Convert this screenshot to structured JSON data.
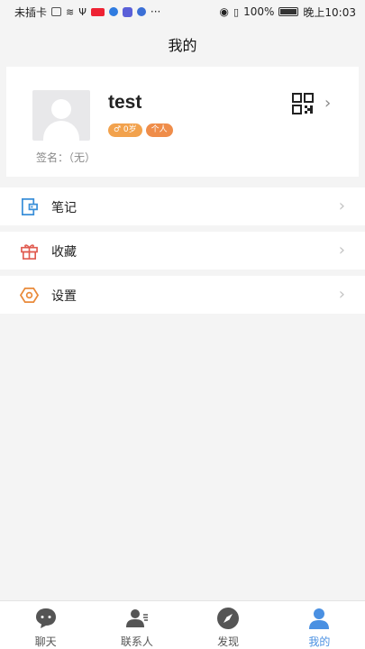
{
  "status_bar": {
    "carrier": "未插卡",
    "more": "···",
    "battery": "100%",
    "time": "晚上10:03",
    "red_badge": "头条"
  },
  "header": {
    "title": "我的"
  },
  "profile": {
    "username": "test",
    "age_badge": "♂ 0岁",
    "type_badge": "个人",
    "signature": "签名：（无）",
    "arrow": "›"
  },
  "menu": {
    "items": [
      {
        "label": "笔记",
        "icon": "note-icon",
        "color": "#3a8fd9"
      },
      {
        "label": "收藏",
        "icon": "gift-icon",
        "color": "#e05a4f"
      },
      {
        "label": "设置",
        "icon": "settings-icon",
        "color": "#e98a3a"
      }
    ],
    "arrow": "›"
  },
  "tabbar": {
    "tabs": [
      {
        "label": "聊天",
        "icon": "chat-icon"
      },
      {
        "label": "联系人",
        "icon": "contacts-icon"
      },
      {
        "label": "发现",
        "icon": "compass-icon"
      },
      {
        "label": "我的",
        "icon": "profile-icon",
        "active": true
      }
    ]
  },
  "colors": {
    "accent": "#4a90e2",
    "background": "#f4f4f4"
  }
}
